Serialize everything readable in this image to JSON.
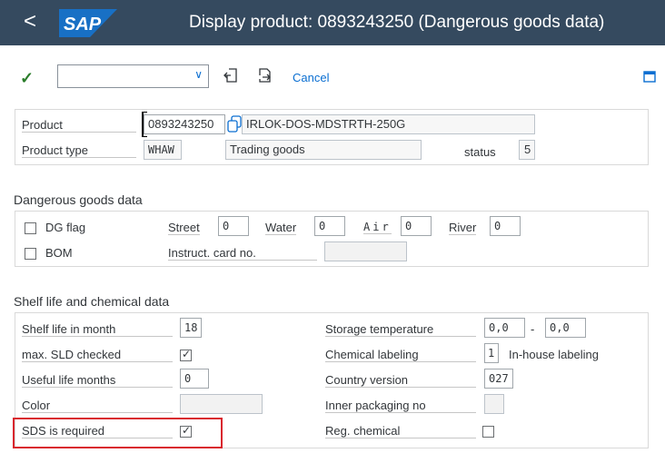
{
  "header": {
    "back_icon": "chevron-left-icon",
    "logo_text": "SAP",
    "logo_colors": [
      "#1870c5",
      "#ffffff"
    ],
    "title": "Display product: 0893243250 (Dangerous goods data)"
  },
  "toolbar": {
    "enter_icon": "checkmark-icon",
    "command_value": "",
    "icons": [
      "back-document-icon",
      "forward-document-icon"
    ],
    "cancel_label": "Cancel",
    "right_icon": "window-icon"
  },
  "product": {
    "product_label": "Product",
    "product_value": "0893243250",
    "product_desc": "IRLOK-DOS-MDSTRTH-250G",
    "type_label": "Product type",
    "type_value": "WHAW",
    "type_desc": "Trading goods",
    "status_label": "status",
    "status_value": "5"
  },
  "dg": {
    "title": "Dangerous goods data",
    "dg_flag_label": "DG flag",
    "bom_label": "BOM",
    "street_label": "Street",
    "street_value": "0",
    "water_label": "Water",
    "water_value": "0",
    "air_label": "Air",
    "air_value": "0",
    "river_label": "River",
    "river_value": "0",
    "instruct_label": "Instruct. card no.",
    "instruct_value": ""
  },
  "shelf": {
    "title": "Shelf life and chemical data",
    "shelf_life_label": "Shelf life in month",
    "shelf_life_value": "18",
    "max_sld_label": "max. SLD checked",
    "useful_life_label": "Useful life months",
    "useful_life_value": "0",
    "color_label": "Color",
    "color_value": "",
    "sds_label": "SDS is required",
    "storage_label": "Storage temperature",
    "storage_from": "0,0",
    "storage_sep": "-",
    "storage_to": "0,0",
    "chem_label": "Chemical labeling",
    "chem_value": "1",
    "chem_desc": "In-house labeling",
    "country_label": "Country version",
    "country_value": "027",
    "inner_label": "Inner packaging no",
    "inner_value": "",
    "reg_label": "Reg. chemical"
  },
  "colors": {
    "header_bg": "#354a5f",
    "link": "#0a6ed1",
    "highlight": "#d9262e"
  }
}
